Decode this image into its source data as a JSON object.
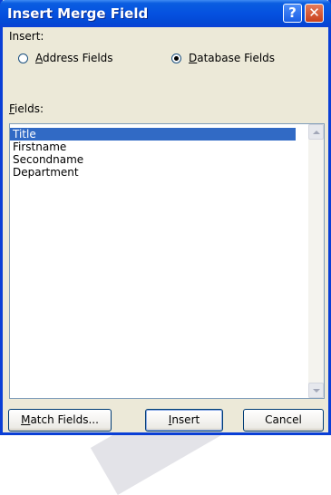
{
  "window": {
    "title": "Insert Merge Field",
    "help_glyph": "?",
    "close_glyph": "✕"
  },
  "insert_group": {
    "label": "Insert:",
    "options": [
      {
        "access_key": "A",
        "rest": "ddress Fields",
        "checked": false
      },
      {
        "access_key": "D",
        "rest": "atabase Fields",
        "checked": true
      }
    ]
  },
  "fields_group": {
    "label_access_key": "F",
    "label_rest": "ields:",
    "items": [
      "Title",
      "Firstname",
      "Secondname",
      "Department"
    ],
    "selected_index": 0
  },
  "buttons": {
    "match_fields": {
      "access_key": "M",
      "rest": "atch Fields..."
    },
    "insert": {
      "access_key": "I",
      "rest": "nsert"
    },
    "cancel": "Cancel"
  },
  "colors": {
    "titlebar": "#0551e0",
    "selection": "#316ac5",
    "dialog_bg": "#ece9d8"
  }
}
